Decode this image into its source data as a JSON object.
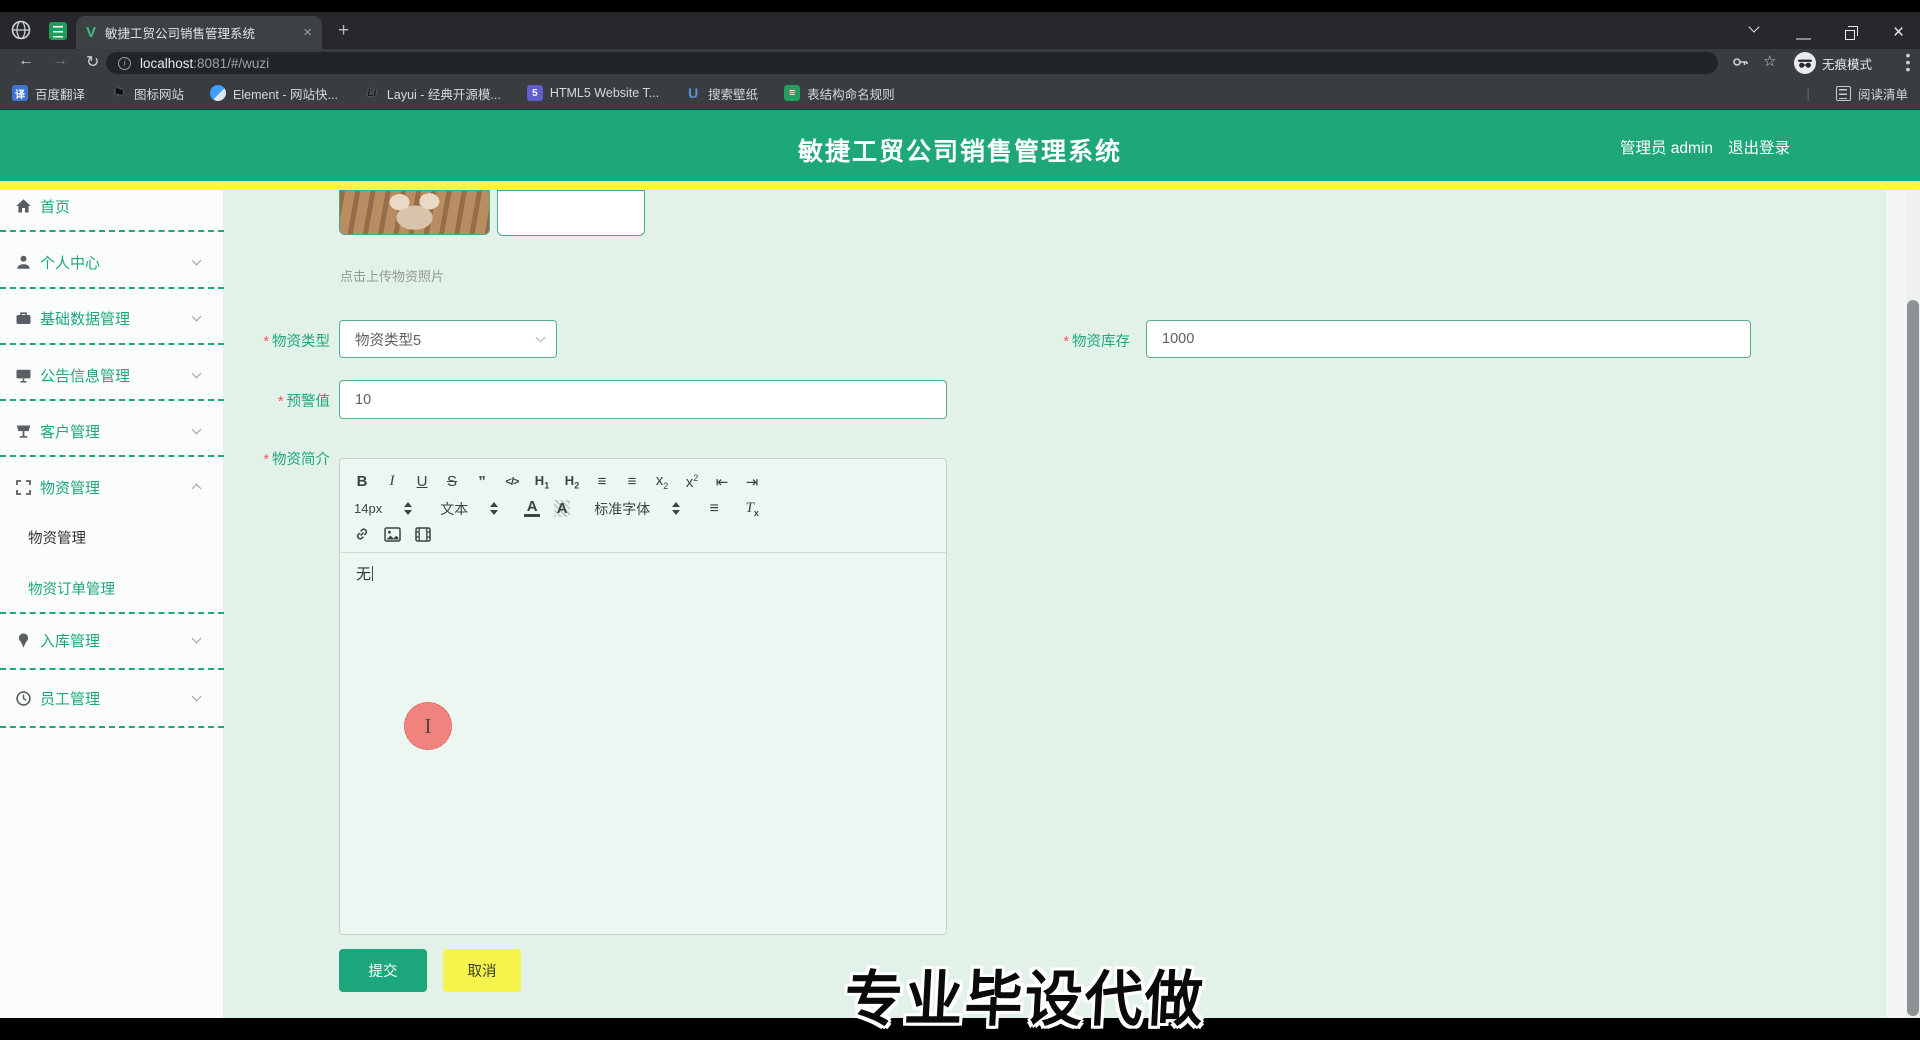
{
  "theme": {
    "header_green": "#1fa77c",
    "accent_yellow": "#f8f63e",
    "content_bg": "#e2f2e9",
    "sidebar_bg": "#fbfdfc",
    "submit_green": "#1ca87c",
    "cancel_yellow": "#f4f44c",
    "cursor_pink": "#f0837e",
    "label_red": "#f45b5b"
  },
  "browser": {
    "tab_title": "敏捷工贸公司销售管理系统",
    "new_tab_glyph": "+",
    "close_tab_glyph": "×",
    "url_host": "localhost",
    "url_rest": ":8081/#/wuzi",
    "incognito_label": "无痕模式",
    "reading_list_label": "阅读清单",
    "bookmarks": [
      {
        "label": "百度翻译",
        "icon": "baidu-translate-icon",
        "glyph": "译",
        "color": "#3f76d6"
      },
      {
        "label": "图标网站",
        "icon": "flag-icon",
        "glyph": "⚑",
        "color": "#0e0f10"
      },
      {
        "label": "Element - 网站快...",
        "icon": "element-icon",
        "glyph": "",
        "color": "#3f9eff"
      },
      {
        "label": "Layui - 经典开源模...",
        "icon": "layui-icon",
        "glyph": "Li",
        "color": "#17191b"
      },
      {
        "label": "HTML5 Website T...",
        "icon": "html5-icon",
        "glyph": "5",
        "color": "#635bd2"
      },
      {
        "label": "搜索壁纸",
        "icon": "wallpaper-icon",
        "glyph": "U",
        "color": "#5b8fd9"
      },
      {
        "label": "表结构命名规则",
        "icon": "table-icon",
        "glyph": "≡",
        "color": "#21a05f"
      }
    ]
  },
  "header": {
    "title": "敏捷工贸公司销售管理系统",
    "user": "管理员 admin",
    "logout": "退出登录"
  },
  "sidebar": {
    "items": [
      {
        "label": "首页",
        "icon": "home-icon"
      },
      {
        "label": "个人中心",
        "icon": "user-icon"
      },
      {
        "label": "基础数据管理",
        "icon": "briefcase-icon"
      },
      {
        "label": "公告信息管理",
        "icon": "monitor-icon"
      },
      {
        "label": "客户管理",
        "icon": "kiosk-icon"
      },
      {
        "label": "物资管理",
        "icon": "brackets-icon",
        "children": [
          {
            "label": "物资管理"
          },
          {
            "label": "物资订单管理"
          }
        ]
      },
      {
        "label": "入库管理",
        "icon": "pin-icon"
      },
      {
        "label": "员工管理",
        "icon": "clock-icon"
      }
    ]
  },
  "form": {
    "upload_hint": "点击上传物资照片",
    "type_label": "物资类型",
    "type_value": "物资类型5",
    "stock_label": "物资库存",
    "stock_value": "1000",
    "warn_label": "预警值",
    "warn_value": "10",
    "intro_label": "物资简介",
    "intro_content": "无",
    "submit_label": "提交",
    "cancel_label": "取消"
  },
  "editor_toolbar": {
    "size_value": "14px",
    "format_value": "文本",
    "font_value": "标准字体",
    "row1_icons": [
      "bold",
      "italic",
      "underline",
      "strike",
      "blockquote",
      "code",
      "header1",
      "header2",
      "ordered-list",
      "bullet-list",
      "subscript",
      "superscript",
      "outdent",
      "indent"
    ],
    "row2_icons": [
      "size-select",
      "format-select",
      "text-color",
      "highlight",
      "font-select",
      "align",
      "clear-format"
    ],
    "row3_icons": [
      "link",
      "image",
      "video"
    ]
  },
  "watermark": "专业毕设代做"
}
